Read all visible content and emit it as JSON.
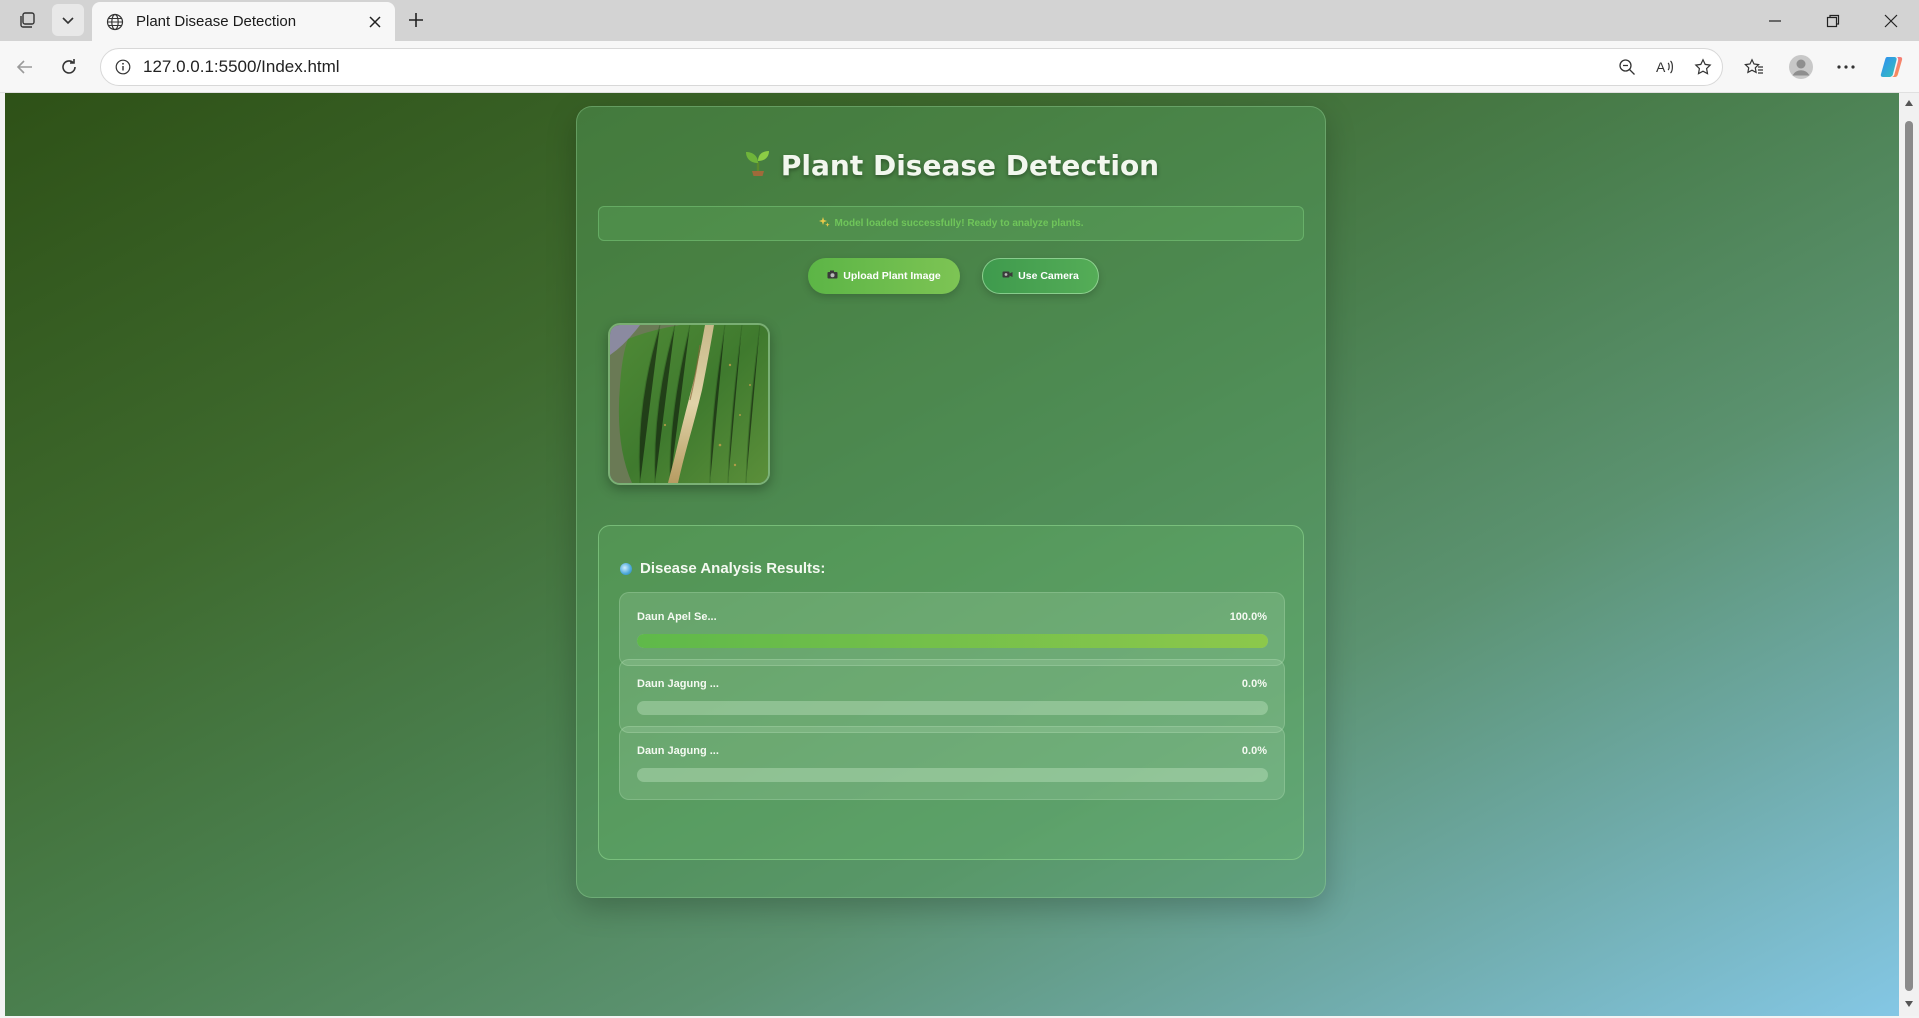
{
  "browser": {
    "tab_title": "Plant Disease Detection",
    "url": "127.0.0.1:5500/Index.html"
  },
  "app": {
    "title": "Plant Disease Detection",
    "status": "Model loaded successfully! Ready to analyze plants.",
    "upload_label": "Upload Plant Image",
    "camera_label": "Use Camera",
    "results_title": "Disease Analysis Results:",
    "results": [
      {
        "label": "Daun Apel Se...",
        "percent_text": "100.0%",
        "value": 1.0
      },
      {
        "label": "Daun Jagung ...",
        "percent_text": "0.0%",
        "value": 0.0
      },
      {
        "label": "Daun Jagung ...",
        "percent_text": "0.0%",
        "value": 0.0
      }
    ]
  },
  "colors": {
    "accent_green": "#5cb546",
    "bar_fill": "#8cc84b",
    "status_text": "#6fc55a"
  },
  "icons": {
    "title": "seedling-icon",
    "status": "sparkles-icon",
    "upload": "camera-icon",
    "camera": "video-camera-icon",
    "results": "blue-dot-icon"
  }
}
